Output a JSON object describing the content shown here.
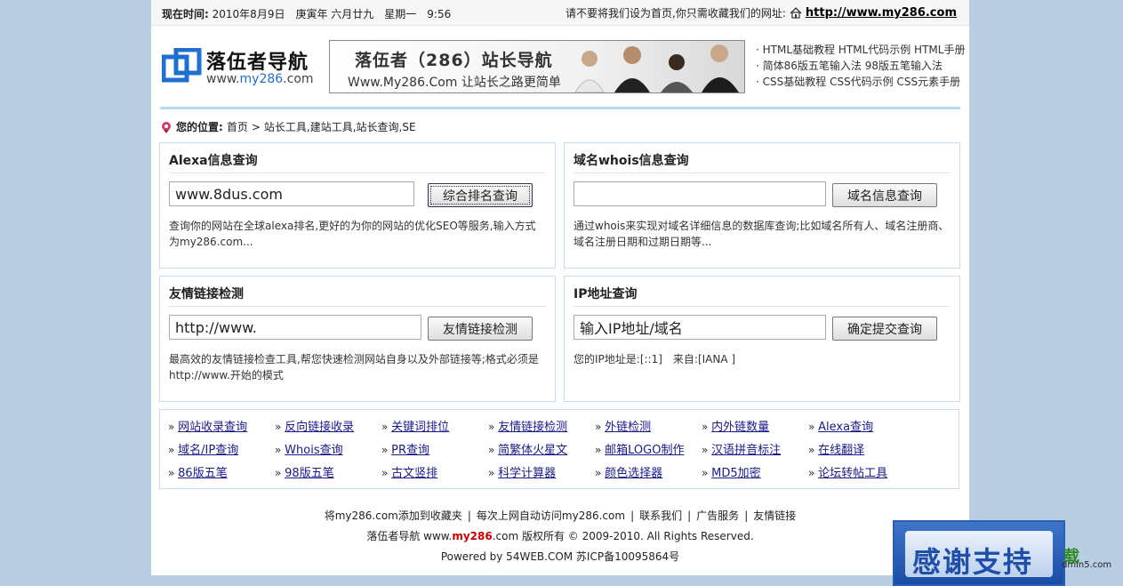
{
  "topbar": {
    "time_label": "现在时间:",
    "time_value": "2010年8月9日　庚寅年 六月廿九　星期一　9:56",
    "notice": "请不要将我们设为首页,你只需收藏我们的网址:",
    "site_url": "http://www.my286.com"
  },
  "logo": {
    "title": "落伍者导航",
    "url_prefix": "www.",
    "url_mid": "my286",
    "url_suffix": ".com"
  },
  "banner": {
    "title": "落伍者（286）站长导航",
    "subtitle": "Www.My286.Com 让站长之路更简单"
  },
  "header_links": [
    "HTML基础教程 HTML代码示例 HTML手册",
    "简体86版五笔输入法 98版五笔输入法",
    "CSS基础教程 CSS代码示例 CSS元素手册"
  ],
  "breadcrumb": {
    "label": "您的位置:",
    "home": "首页",
    "path": "站长工具,建站工具,站长查询,SE"
  },
  "panels": {
    "alexa": {
      "title": "Alexa信息查询",
      "value": "www.8dus.com",
      "button": "综合排名查询",
      "desc": "查询你的网站在全球alexa排名,更好的为你的网站的优化SEO等服务,输入方式为my286.com..."
    },
    "whois": {
      "title": "域名whois信息查询",
      "value": "",
      "button": "域名信息查询",
      "desc": "通过whois来实现对域名详细信息的数据库查询;比如域名所有人、域名注册商、域名注册日期和过期日期等..."
    },
    "friendlink": {
      "title": "友情链接检测",
      "value": "http://www.",
      "button": "友情链接检测",
      "desc": "最高效的友情链接检查工具,帮您快速检测网站自身以及外部链接等;格式必须是http://www.开始的模式"
    },
    "ip": {
      "title": "IP地址查询",
      "value": "输入IP地址/域名",
      "button": "确定提交查询",
      "desc": "您的IP地址是:[::1]　来自:[IANA ]"
    }
  },
  "tools": [
    [
      "网站收录查询",
      "反向链接收录",
      "关键词排位",
      "友情链接检测",
      "外链检测",
      "内外链数量",
      "Alexa查询"
    ],
    [
      "域名/IP查询",
      "Whois查询",
      "PR查询",
      "简繁体火星文",
      "邮箱LOGO制作",
      "汉语拼音标注",
      "在线翻译"
    ],
    [
      "86版五笔",
      "98版五笔",
      "古文竖排",
      "科学计算器",
      "颜色选择器",
      "MD5加密",
      "论坛转帖工具"
    ]
  ],
  "footer": {
    "links": [
      "将my286.com添加到收藏夹",
      "每次上网自动访问my286.com",
      "联系我们",
      "广告服务",
      "友情链接"
    ],
    "copyright_a": "落伍者导航 www.",
    "copyright_red": "my286",
    "copyright_b": ".com 版权所有 © 2009-2010. All Rights Reserved.",
    "powered": "Powered by 54WEB.COM 苏ICP备10095864号"
  },
  "overlay": {
    "thanks": "感谢支持",
    "side_logo": "载",
    "side_url": "dmin5.com"
  },
  "colors": {
    "page_bg": "#b9cde3",
    "panel_border": "#c9dcea",
    "link": "#1a1a8a",
    "accent_red": "#c00000"
  }
}
